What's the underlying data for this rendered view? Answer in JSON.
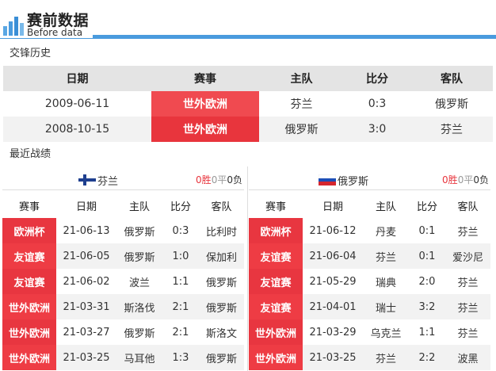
{
  "header": {
    "title_cn": "赛前数据",
    "title_en": "Before data"
  },
  "colors": {
    "accent": "#4a9bde",
    "competition_red": "#e8353d"
  },
  "h2h": {
    "section_title": "交锋历史",
    "columns": [
      "日期",
      "赛事",
      "主队",
      "比分",
      "客队"
    ],
    "rows": [
      {
        "date": "2009-06-11",
        "comp": "世外欧洲",
        "home": "芬兰",
        "score": "0:3",
        "away": "俄罗斯"
      },
      {
        "date": "2008-10-15",
        "comp": "世外欧洲",
        "home": "俄罗斯",
        "score": "3:0",
        "away": "芬兰"
      }
    ]
  },
  "recent": {
    "section_title": "最近战绩",
    "columns": [
      "赛事",
      "日期",
      "主队",
      "比分",
      "客队"
    ],
    "left": {
      "team": "芬兰",
      "flag": "finland-flag-icon",
      "wins": "0",
      "win_label": "胜",
      "draws": "0",
      "draw_label": "平",
      "losses": "0",
      "loss_label": "负",
      "rows": [
        {
          "comp": "欧洲杯",
          "date": "21-06-13",
          "home": "俄罗斯",
          "score": "0:3",
          "away": "比利时"
        },
        {
          "comp": "友谊赛",
          "date": "21-06-05",
          "home": "俄罗斯",
          "score": "1:0",
          "away": "保加利"
        },
        {
          "comp": "友谊赛",
          "date": "21-06-02",
          "home": "波兰",
          "score": "1:1",
          "away": "俄罗斯"
        },
        {
          "comp": "世外欧洲",
          "date": "21-03-31",
          "home": "斯洛伐",
          "score": "2:1",
          "away": "俄罗斯"
        },
        {
          "comp": "世外欧洲",
          "date": "21-03-27",
          "home": "俄罗斯",
          "score": "2:1",
          "away": "斯洛文"
        },
        {
          "comp": "世外欧洲",
          "date": "21-03-25",
          "home": "马耳他",
          "score": "1:3",
          "away": "俄罗斯"
        }
      ]
    },
    "right": {
      "team": "俄罗斯",
      "flag": "russia-flag-icon",
      "wins": "0",
      "win_label": "胜",
      "draws": "0",
      "draw_label": "平",
      "losses": "0",
      "loss_label": "负",
      "rows": [
        {
          "comp": "欧洲杯",
          "date": "21-06-12",
          "home": "丹麦",
          "score": "0:1",
          "away": "芬兰"
        },
        {
          "comp": "友谊赛",
          "date": "21-06-04",
          "home": "芬兰",
          "score": "0:1",
          "away": "爱沙尼"
        },
        {
          "comp": "友谊赛",
          "date": "21-05-29",
          "home": "瑞典",
          "score": "2:0",
          "away": "芬兰"
        },
        {
          "comp": "友谊赛",
          "date": "21-04-01",
          "home": "瑞士",
          "score": "3:2",
          "away": "芬兰"
        },
        {
          "comp": "世外欧洲",
          "date": "21-03-29",
          "home": "乌克兰",
          "score": "1:1",
          "away": "芬兰"
        },
        {
          "comp": "世外欧洲",
          "date": "21-03-25",
          "home": "芬兰",
          "score": "2:2",
          "away": "波黑"
        }
      ]
    }
  }
}
